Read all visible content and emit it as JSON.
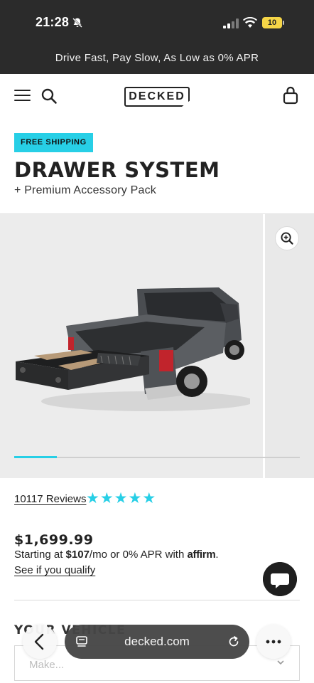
{
  "status_bar": {
    "time": "21:28",
    "battery": "10",
    "icons": [
      "bell-slash-icon",
      "cellular-signal-icon",
      "wifi-icon",
      "battery-icon"
    ]
  },
  "promo_banner": {
    "text": "Drive Fast, Pay Slow, As Low as 0% APR"
  },
  "header": {
    "logo_text": "DECKED",
    "icons": [
      "menu-icon",
      "search-icon",
      "cart-bag-icon"
    ]
  },
  "product": {
    "badge": "FREE SHIPPING",
    "title": "DRAWER SYSTEM",
    "subtitle": "+ Premium Accessory Pack",
    "gallery": {
      "progress": 0.15,
      "zoom_icon": "zoom-in-icon"
    },
    "reviews": {
      "count_label": "10117 Reviews",
      "rating": 5,
      "max_rating": 5
    },
    "price": "$1,699.99",
    "financing": {
      "prefix": "Starting at ",
      "amount": "$107",
      "suffix": "/mo or 0% APR with ",
      "provider": "affirm",
      "end": "."
    },
    "qualify_link": "See if you qualify"
  },
  "vehicle": {
    "label": "YOUR VEHICLE",
    "make_placeholder": "Make..."
  },
  "browser": {
    "url": "decked.com",
    "icons": [
      "back-chevron-icon",
      "tabs-icon",
      "reload-icon",
      "more-icon"
    ]
  },
  "colors": {
    "accent": "#27cfe6",
    "banner_bg": "#2b2b2b",
    "text": "#222222"
  }
}
